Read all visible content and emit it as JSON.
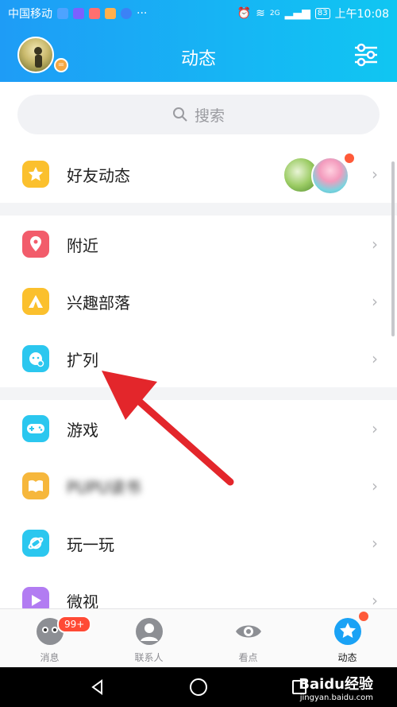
{
  "status_bar": {
    "carrier": "中国移动",
    "network": "2G",
    "battery": "83",
    "time": "上午10:08"
  },
  "header": {
    "title": "动态"
  },
  "search": {
    "placeholder": "搜索"
  },
  "sections": [
    {
      "items": [
        {
          "label": "好友动态",
          "icon": "star-icon",
          "color": "#fbc02d"
        }
      ]
    },
    {
      "items": [
        {
          "label": "附近",
          "icon": "location-pin-icon",
          "color": "#f25c6b"
        },
        {
          "label": "兴趣部落",
          "icon": "tent-icon",
          "color": "#fbc02d"
        },
        {
          "label": "扩列",
          "icon": "chat-face-icon",
          "color": "#2bc7ef"
        }
      ]
    },
    {
      "items": [
        {
          "label": "游戏",
          "icon": "gamepad-icon",
          "color": "#2bc7ef"
        },
        {
          "label": "PUPU读书",
          "icon": "book-icon",
          "color": "#f6b73c"
        },
        {
          "label": "玩一玩",
          "icon": "planet-icon",
          "color": "#2bc7ef"
        },
        {
          "label": "微视",
          "icon": "video-icon",
          "color": "#b27cf2"
        }
      ]
    }
  ],
  "tabs": [
    {
      "label": "消息",
      "badge": "99+"
    },
    {
      "label": "联系人"
    },
    {
      "label": "看点"
    },
    {
      "label": "动态"
    }
  ],
  "watermark": {
    "brand": "Baidu经验",
    "url": "jingyan.baidu.com"
  },
  "colors": {
    "header_start": "#1e9cf6",
    "header_end": "#10c6f2",
    "arrow": "#e3262b",
    "badge": "#ff4a35"
  }
}
